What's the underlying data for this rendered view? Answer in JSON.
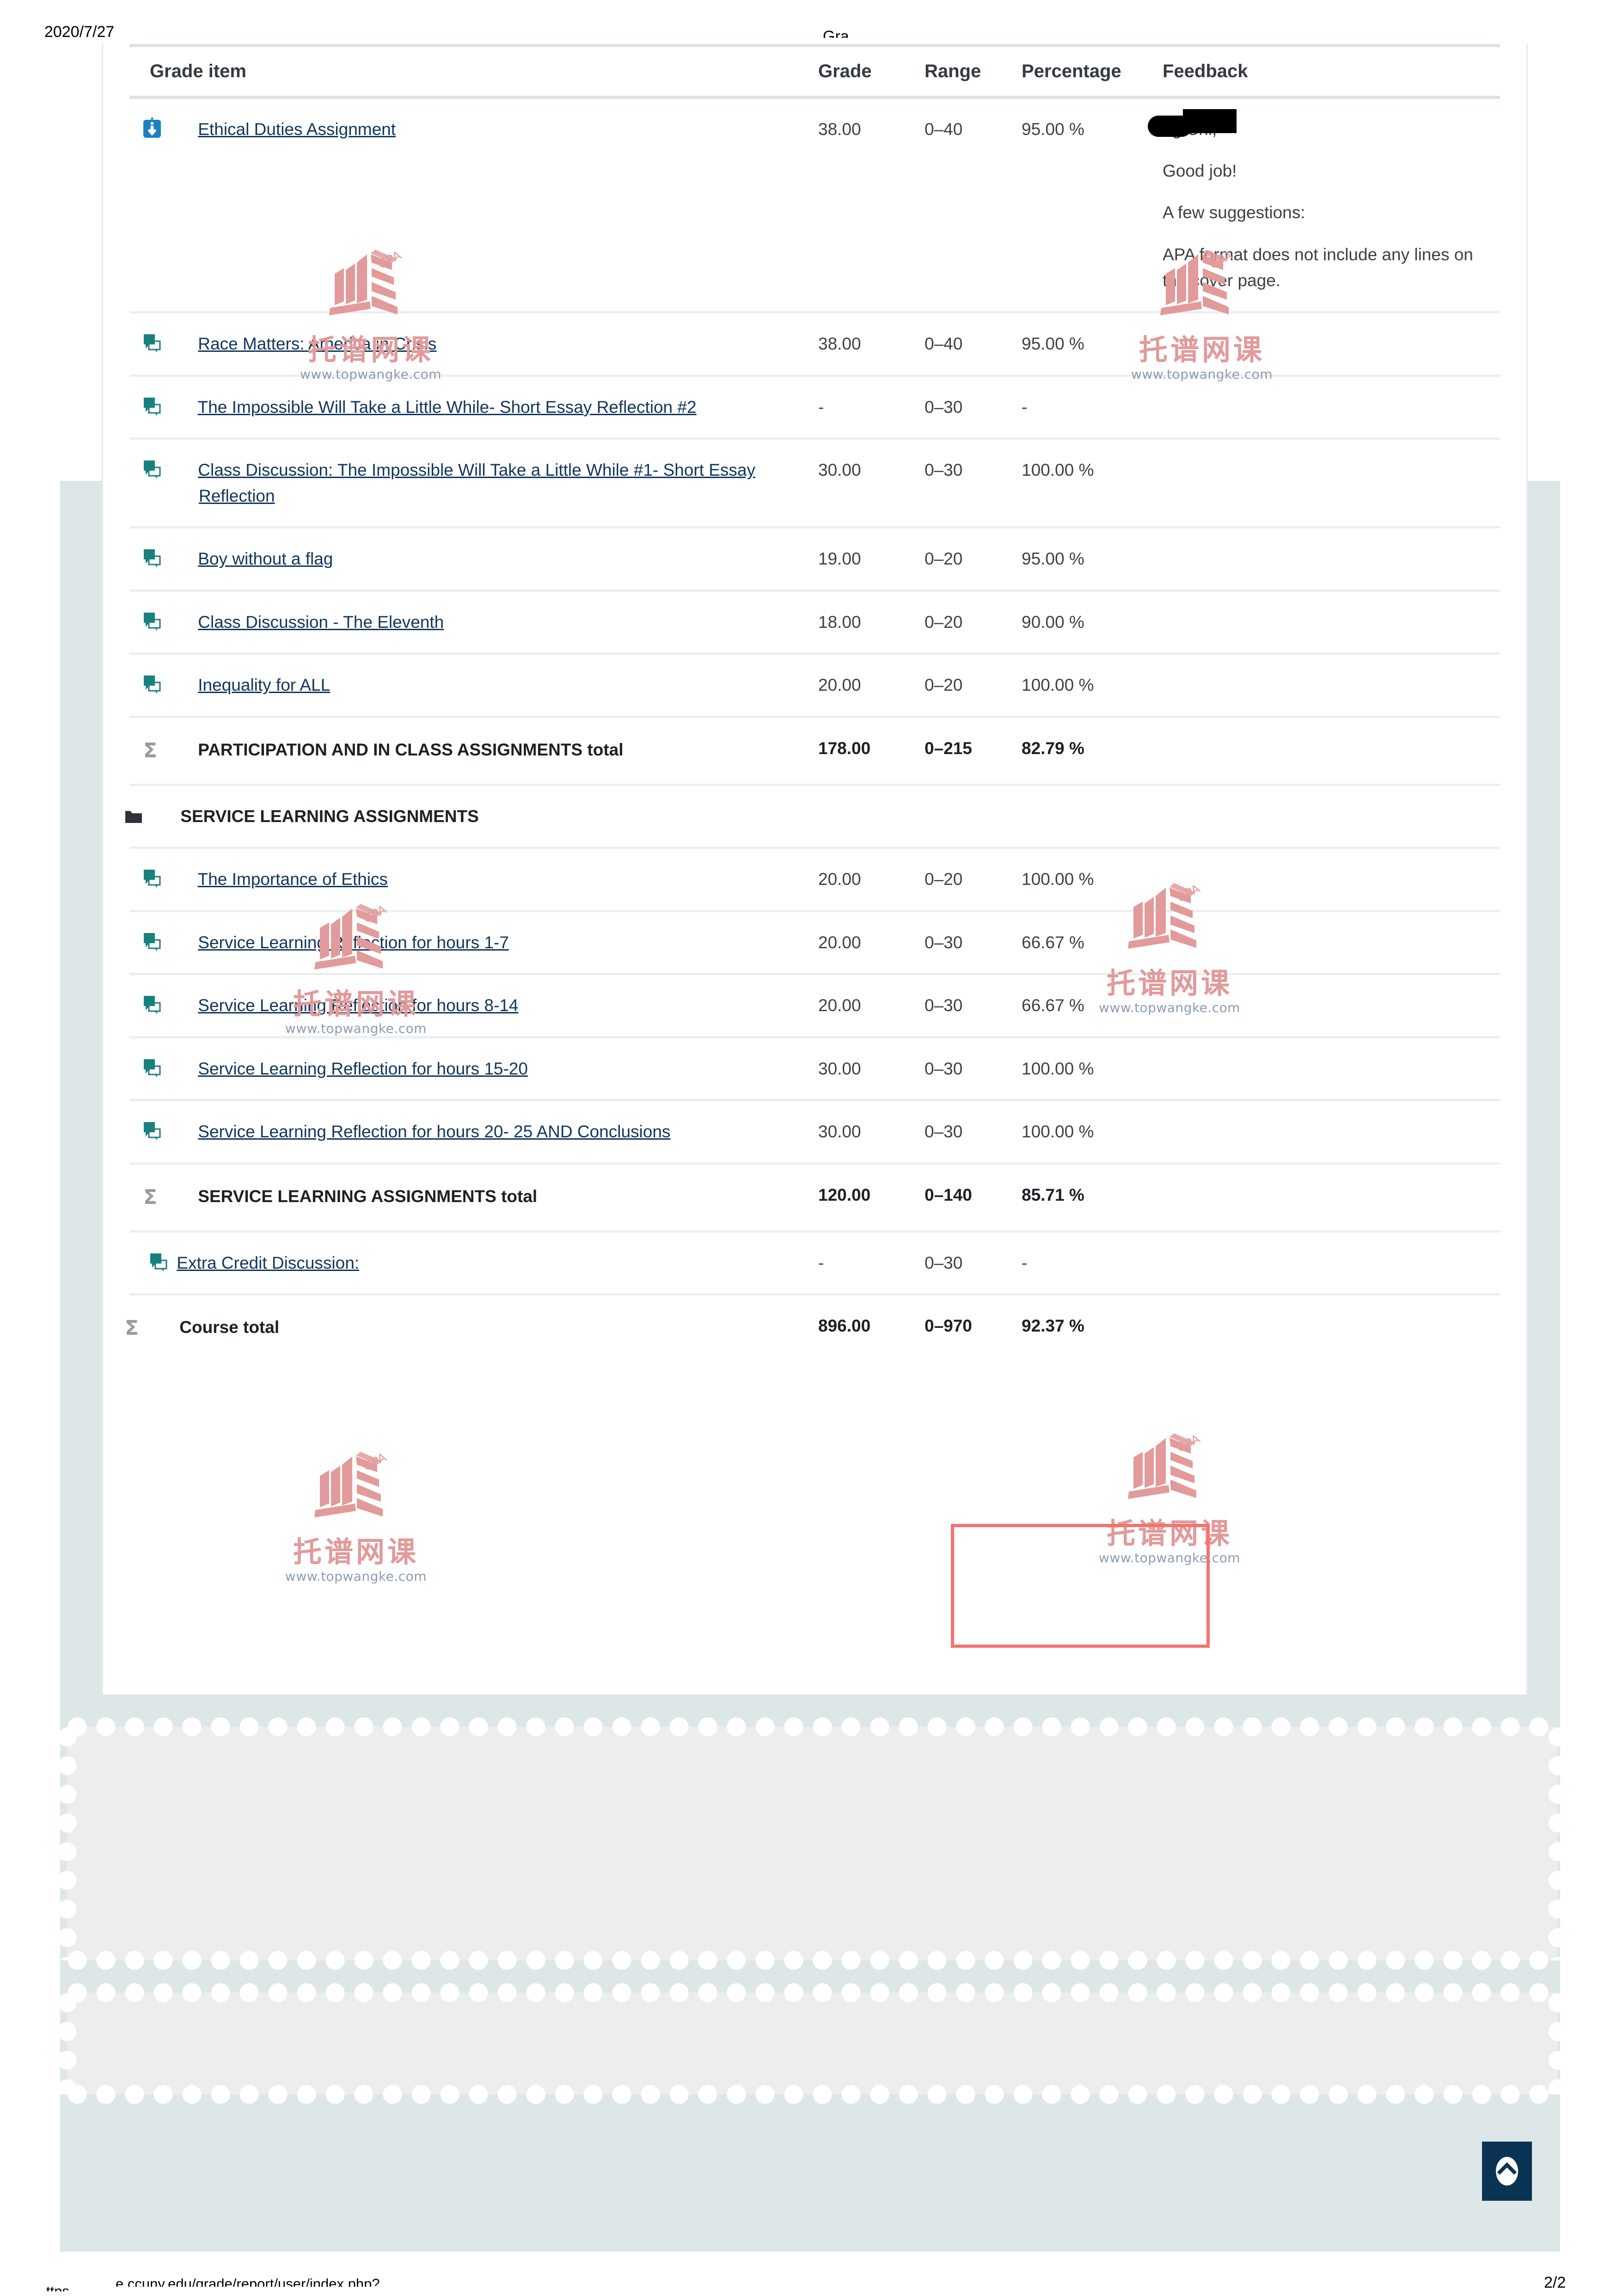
{
  "print_header": {
    "date": "2020/7/27",
    "title_clipped": "Gra"
  },
  "table": {
    "columns": [
      "Grade item",
      "Grade",
      "Range",
      "Percentage",
      "Feedback"
    ],
    "rows": [
      {
        "kind": "item",
        "icon": "assignment-icon",
        "level": 2,
        "name": "Ethical Duties Assignment",
        "grade": "38.00",
        "range": "0–40",
        "percentage": "95.00 %",
        "feedback": {
          "greeting_suffix": "ng Chi,",
          "lines": [
            "Good job!",
            "A few suggestions:",
            "APA format does not include any lines on the cover page."
          ]
        }
      },
      {
        "kind": "item",
        "icon": "forum-icon",
        "level": 2,
        "name": "Race Matters: America in Crisis",
        "grade": "38.00",
        "range": "0–40",
        "percentage": "95.00 %",
        "feedback": null
      },
      {
        "kind": "item",
        "icon": "forum-icon",
        "level": 2,
        "name": "The Impossible Will Take a Little While- Short Essay Reflection #2",
        "grade": "-",
        "range": "0–30",
        "percentage": "-",
        "feedback": null
      },
      {
        "kind": "item",
        "icon": "forum-icon",
        "level": 2,
        "name": "Class Discussion: The Impossible Will Take a Little While #1- Short Essay Reflection",
        "grade": "30.00",
        "range": "0–30",
        "percentage": "100.00 %",
        "feedback": null
      },
      {
        "kind": "item",
        "icon": "forum-icon",
        "level": 2,
        "name": "Boy without a flag",
        "grade": "19.00",
        "range": "0–20",
        "percentage": "95.00 %",
        "feedback": null
      },
      {
        "kind": "item",
        "icon": "forum-icon",
        "level": 2,
        "name": "Class Discussion - The Eleventh",
        "grade": "18.00",
        "range": "0–20",
        "percentage": "90.00 %",
        "feedback": null
      },
      {
        "kind": "item",
        "icon": "forum-icon",
        "level": 2,
        "name": "Inequality for ALL",
        "grade": "20.00",
        "range": "0–20",
        "percentage": "100.00 %",
        "feedback": null
      },
      {
        "kind": "total",
        "icon": "sigma-icon",
        "name": "PARTICIPATION AND IN CLASS ASSIGNMENTS total",
        "grade": "178.00",
        "range": "0–215",
        "percentage": "82.79 %",
        "feedback": null
      },
      {
        "kind": "category",
        "icon": "folder-icon",
        "name": "SERVICE LEARNING ASSIGNMENTS",
        "grade": "",
        "range": "",
        "percentage": "",
        "feedback": null
      },
      {
        "kind": "item",
        "icon": "forum-icon",
        "level": 2,
        "name": "The Importance of Ethics",
        "grade": "20.00",
        "range": "0–20",
        "percentage": "100.00 %",
        "feedback": null
      },
      {
        "kind": "item",
        "icon": "forum-icon",
        "level": 2,
        "name": "Service Learning Reflection for hours 1-7",
        "grade": "20.00",
        "range": "0–30",
        "percentage": "66.67 %",
        "feedback": null
      },
      {
        "kind": "item",
        "icon": "forum-icon",
        "level": 2,
        "name": "Service Learning Reflection for hours 8-14",
        "grade": "20.00",
        "range": "0–30",
        "percentage": "66.67 %",
        "feedback": null
      },
      {
        "kind": "item",
        "icon": "forum-icon",
        "level": 2,
        "name": "Service Learning Reflection for hours 15-20",
        "grade": "30.00",
        "range": "0–30",
        "percentage": "100.00 %",
        "feedback": null
      },
      {
        "kind": "item",
        "icon": "forum-icon",
        "level": 2,
        "name": "Service Learning Reflection for hours 20- 25 AND Conclusions",
        "grade": "30.00",
        "range": "0–30",
        "percentage": "100.00 %",
        "feedback": null
      },
      {
        "kind": "total",
        "icon": "sigma-icon",
        "name": "SERVICE LEARNING ASSIGNMENTS total",
        "grade": "120.00",
        "range": "0–140",
        "percentage": "85.71 %",
        "feedback": null
      },
      {
        "kind": "item",
        "icon": "forum-icon",
        "level": 1,
        "name": "Extra Credit Discussion:",
        "grade": "-",
        "range": "0–30",
        "percentage": "-",
        "feedback": null
      },
      {
        "kind": "coursetotal",
        "icon": "sigma-icon",
        "name": "Course total",
        "grade": "896.00",
        "range": "0–970",
        "percentage": "92.37 %",
        "feedback": null
      }
    ]
  },
  "annotation": {
    "highlight_label": "red-highlight-course-total"
  },
  "buttons": {
    "scroll_top": "scroll-to-top"
  },
  "footer": {
    "url": "e.ccuny.edu/grade/report/user/index.php?",
    "url_fragment": "ttps",
    "page": "2/2"
  },
  "watermark": {
    "badge_text": "GPA",
    "brand_cn": "托谱网课",
    "brand_url": "www.topwangke.com"
  },
  "colors": {
    "link": "#11365c",
    "assignment_icon": "#1b81c0",
    "forum_icon": "#18817e",
    "highlight": "#f4736f",
    "teal_panel": "#dde7e7",
    "scallop": "#ededed",
    "to_top_bg": "#0b3354",
    "watermark_pink": "#e29a9a",
    "watermark_url": "#8b9cb3"
  }
}
